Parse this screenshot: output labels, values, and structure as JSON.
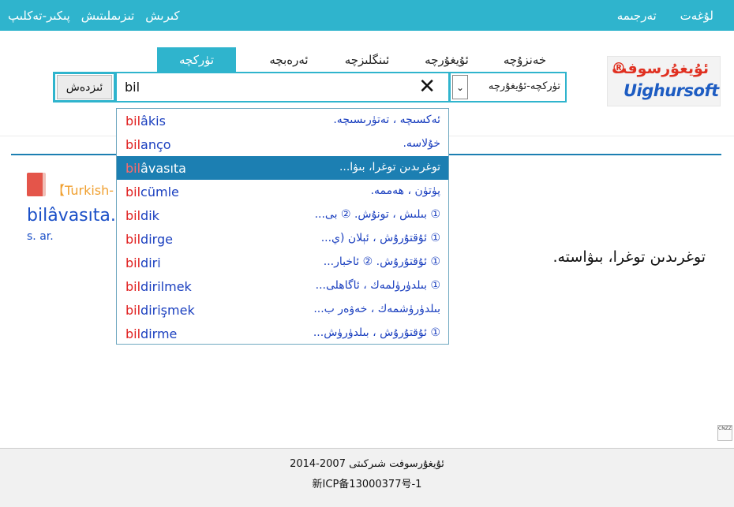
{
  "topbar": {
    "left_links": [
      "كىرىش",
      "تىزىملىتىش",
      "پىكىر-تەكلىپ"
    ],
    "right_links": [
      "لۇغەت",
      "تەرجىمە"
    ]
  },
  "logo": {
    "uyghur_text": "ئۇيغۇرسوفت",
    "registered": "®",
    "english_text": "Uighursoft"
  },
  "tabs": [
    {
      "label": "خەنزۇچە",
      "active": false
    },
    {
      "label": "ئۇيغۇرچە",
      "active": false
    },
    {
      "label": "ئىنگلىزچە",
      "active": false
    },
    {
      "label": "ئەرەبچە",
      "active": false
    },
    {
      "label": "تۈركچە",
      "active": true
    }
  ],
  "search": {
    "language_selected": "تۈركچە-ئۇيغۇرچە",
    "query": "bil",
    "clear_icon": "close-icon",
    "button_label": "ئىزدەش"
  },
  "suggestions": [
    {
      "prefix": "bil",
      "rest": "âkis",
      "gloss": "ئەكسىچە ، تەتۈرىسىچە.",
      "selected": false
    },
    {
      "prefix": "bil",
      "rest": "anço",
      "gloss": "خۇلاسە.",
      "selected": false
    },
    {
      "prefix": "bil",
      "rest": "âvasıta",
      "gloss": "توغرىدىن توغرا، بىۋا...",
      "selected": true
    },
    {
      "prefix": "bil",
      "rest": "cümle",
      "gloss": "پۈتۈن ، ھەممە.",
      "selected": false
    },
    {
      "prefix": "bil",
      "rest": "dik",
      "gloss": "① بىلىش ، تونۇش. ② بى...",
      "selected": false
    },
    {
      "prefix": "bil",
      "rest": "dirge",
      "gloss": "① ئۇقتۇرۇش ، ئېلان (ي...",
      "selected": false
    },
    {
      "prefix": "bil",
      "rest": "diri",
      "gloss": "① ئۇقتۇرۇش. ② ئاخبار...",
      "selected": false
    },
    {
      "prefix": "bil",
      "rest": "dirilmek",
      "gloss": "① بىلدۈرۈلمەك ، ئاگاھلى...",
      "selected": false
    },
    {
      "prefix": "bil",
      "rest": "dirişmek",
      "gloss": "بىلدۈرۈشمەك ، خەۋەر ب...",
      "selected": false
    },
    {
      "prefix": "bil",
      "rest": "dirme",
      "gloss": "① ئۇقتۇرۇش ، بىلدۈرۈش...",
      "selected": false
    }
  ],
  "result": {
    "source_tag": "【Turkish-",
    "headword": "bilâvasıta.",
    "pos": "s. ar.",
    "definition": "توغرىدىن توغرا، بىۋاستە."
  },
  "cnzz": "CNZZ",
  "footer": {
    "line1": "ئۇيغۇرسوفت شىركىتى 2007-2014",
    "line2": "新ICP备13000377号-1"
  },
  "colors": {
    "accent": "#2fb4cd",
    "selected_row": "#1c7fb2",
    "link_blue": "#1a3fbf",
    "highlight_red": "#e02020",
    "tag_orange": "#f0a030"
  }
}
